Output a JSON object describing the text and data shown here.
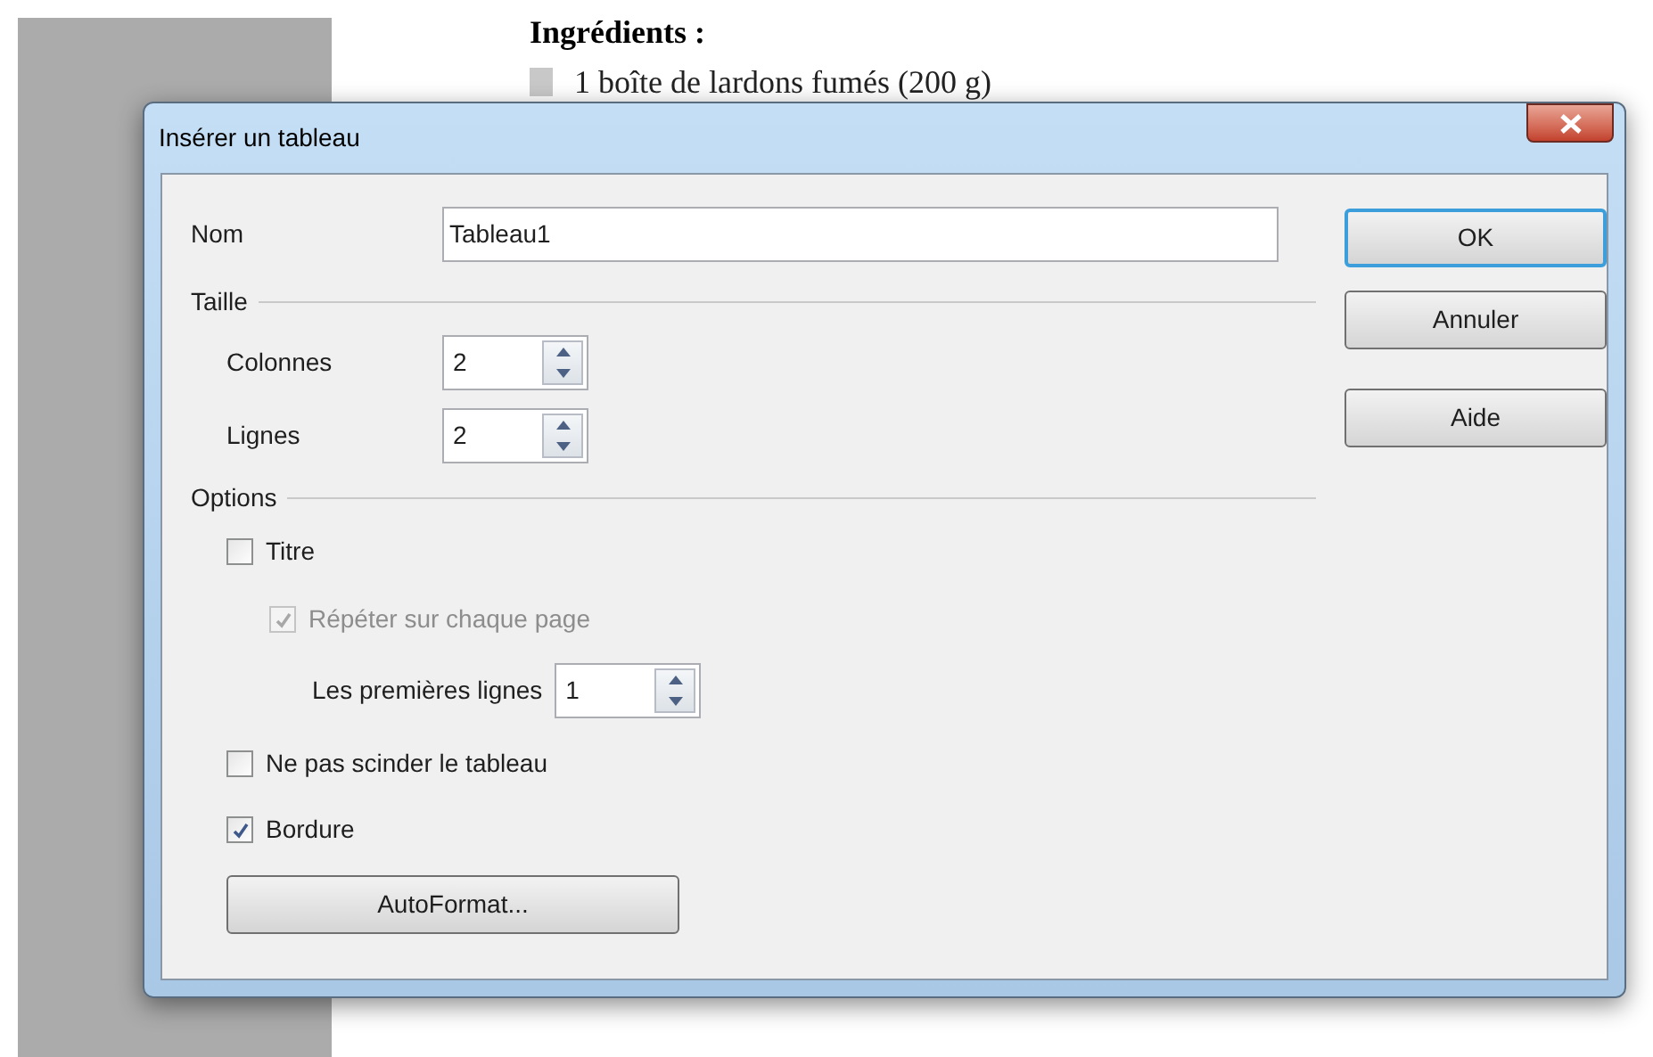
{
  "document": {
    "heading": "Ingrédients :",
    "list_items": [
      "1 boîte de lardons fumés (200 g)"
    ]
  },
  "dialog": {
    "title": "Insérer un tableau",
    "name": {
      "label": "Nom",
      "value": "Tableau1"
    },
    "size": {
      "heading": "Taille",
      "fields": [
        {
          "label": "Colonnes",
          "value": "2"
        },
        {
          "label": "Lignes",
          "value": "2"
        }
      ]
    },
    "options": {
      "heading": "Options",
      "items": [
        {
          "kind": "checkbox",
          "label": "Titre",
          "checked": false,
          "disabled": false
        },
        {
          "kind": "checkbox",
          "label": "Répéter sur chaque page",
          "checked": true,
          "disabled": true
        },
        {
          "kind": "spin",
          "label": "Les premières lignes",
          "value": "1"
        },
        {
          "kind": "checkbox",
          "label": "Ne pas scinder le tableau",
          "checked": false,
          "disabled": false
        },
        {
          "kind": "checkbox",
          "label": "Bordure",
          "checked": true,
          "disabled": false
        }
      ]
    },
    "autoformat_button": "AutoFormat...",
    "buttons": [
      {
        "label": "OK",
        "default": true
      },
      {
        "label": "Annuler",
        "default": false
      },
      {
        "label": "Aide",
        "default": false
      }
    ]
  }
}
